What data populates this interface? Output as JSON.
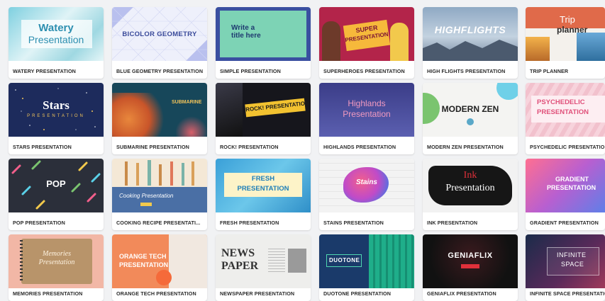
{
  "templates": [
    {
      "name": "WATERY PRESENTATION",
      "thumb_lines": [
        "Watery",
        "Presentation"
      ]
    },
    {
      "name": "BLUE GEOMETRY PRESENTATION",
      "thumb_lines": [
        "BICOLOR GEOMETRY"
      ]
    },
    {
      "name": "SIMPLE PRESENTATION",
      "thumb_lines": [
        "Write a",
        "title here"
      ]
    },
    {
      "name": "SUPERHEROES PRESENTATION",
      "thumb_lines": [
        "SUPER",
        "PRESENTATION"
      ]
    },
    {
      "name": "HIGH FLIGHTS PRESENTATION",
      "thumb_lines": [
        "HIGHFLIGHTS"
      ]
    },
    {
      "name": "TRIP PLANNER",
      "thumb_lines": [
        "Trip",
        "planner"
      ]
    },
    {
      "name": "STARS PRESENTATION",
      "thumb_lines": [
        "Stars",
        "PRESENTATION"
      ]
    },
    {
      "name": "SUBMARINE PRESENTATION",
      "thumb_lines": [
        "SUBMARINE"
      ]
    },
    {
      "name": "ROCK! PRESENTATION",
      "thumb_lines": [
        "ROCK! PRESENTATION"
      ]
    },
    {
      "name": "HIGHLANDS PRESENTATION",
      "thumb_lines": [
        "Highlands",
        "Presentation"
      ]
    },
    {
      "name": "MODERN ZEN PRESENTATION",
      "thumb_lines": [
        "MODERN ZEN"
      ]
    },
    {
      "name": "PSYCHEDELIC PRESENTATION",
      "thumb_lines": [
        "PSYCHEDELIC",
        "PRESENTATION"
      ]
    },
    {
      "name": "POP PRESENTATION",
      "thumb_lines": [
        "POP"
      ]
    },
    {
      "name": "COOKING RECIPE PRESENTATI...",
      "thumb_lines": [
        "Cooking Presentation"
      ]
    },
    {
      "name": "FRESH PRESENTATION",
      "thumb_lines": [
        "FRESH",
        "PRESENTATION"
      ]
    },
    {
      "name": "STAINS PRESENTATION",
      "thumb_lines": [
        "Stains"
      ]
    },
    {
      "name": "INK PRESENTATION",
      "thumb_lines": [
        "Ink",
        "Presentation"
      ]
    },
    {
      "name": "GRADIENT PRESENTATION",
      "thumb_lines": [
        "GRADIENT",
        "PRESENTATION"
      ]
    },
    {
      "name": "MEMORIES PRESENTATION",
      "thumb_lines": [
        "Memories",
        "Presentation"
      ]
    },
    {
      "name": "ORANGE TECH PRESENTATION",
      "thumb_lines": [
        "ORANGE TECH",
        "PRESENTATION"
      ]
    },
    {
      "name": "NEWSPAPER PRESENTATION",
      "thumb_lines": [
        "NEWS",
        "PAPER"
      ]
    },
    {
      "name": "DUOTONE PRESENTATION",
      "thumb_lines": [
        "DUOTONE"
      ]
    },
    {
      "name": "GENIAFLIX PRESENTATION",
      "thumb_lines": [
        "GENIAFLIX"
      ]
    },
    {
      "name": "INFINITE SPACE PRESENTATION",
      "thumb_lines": [
        "INFINITE",
        "SPACE"
      ]
    }
  ]
}
